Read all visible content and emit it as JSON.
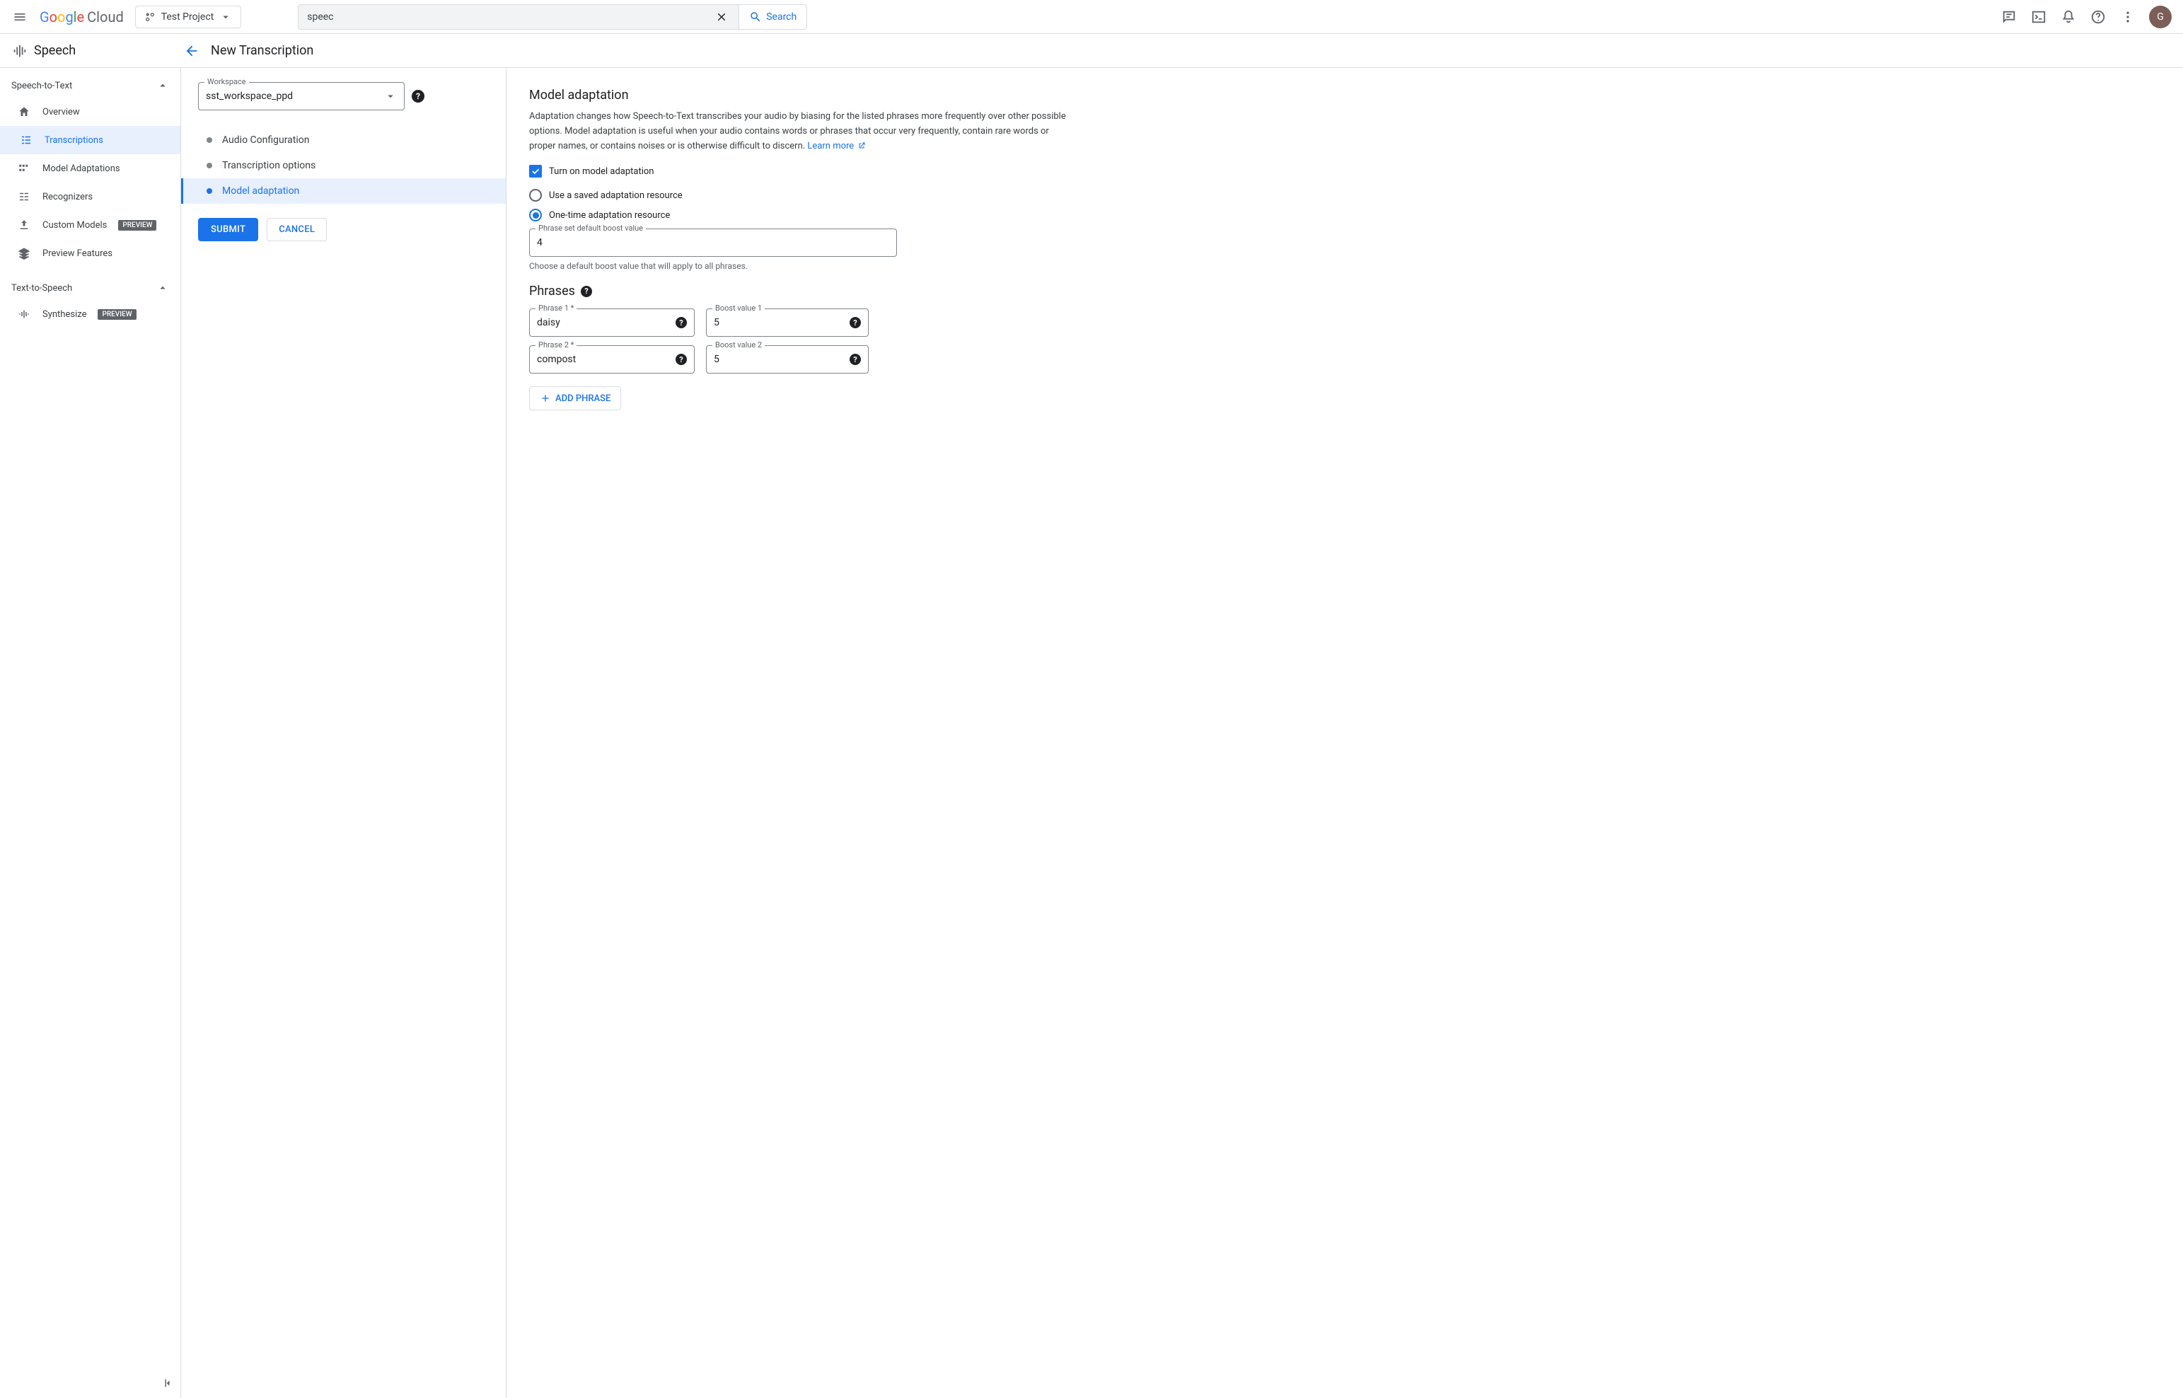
{
  "topbar": {
    "logo_cloud": "Cloud",
    "project": "Test Project",
    "search_value": "speec",
    "search_button": "Search",
    "avatar_letter": "G"
  },
  "product": {
    "name": "Speech",
    "page_title": "New Transcription"
  },
  "sidebar": {
    "section_stt": "Speech-to-Text",
    "items_stt": {
      "overview": "Overview",
      "transcriptions": "Transcriptions",
      "model_adaptations": "Model Adaptations",
      "recognizers": "Recognizers",
      "custom_models": "Custom Models",
      "preview_features": "Preview Features"
    },
    "section_tts": "Text-to-Speech",
    "items_tts": {
      "synthesize": "Synthesize"
    },
    "preview_badge": "PREVIEW"
  },
  "stepper": {
    "workspace_label": "Workspace",
    "workspace_value": "sst_workspace_ppd",
    "steps": {
      "audio": "Audio Configuration",
      "options": "Transcription options",
      "adaptation": "Model adaptation"
    },
    "submit": "SUBMIT",
    "cancel": "CANCEL"
  },
  "content": {
    "title": "Model adaptation",
    "description": "Adaptation changes how Speech-to-Text transcribes your audio by biasing for the listed phrases more frequently over other possible options. Model adaptation is useful when your audio contains words or phrases that occur very frequently, contain rare words or proper names, or contains noises or is otherwise difficult to discern. ",
    "learn_more": "Learn more",
    "checkbox_label": "Turn on model adaptation",
    "radio_saved": "Use a saved adaptation resource",
    "radio_onetime": "One-time adaptation resource",
    "boost_field_label": "Phrase set default boost value",
    "boost_field_value": "4",
    "boost_helper": "Choose a default boost value that will apply to all phrases.",
    "phrases_title": "Phrases",
    "phrases": [
      {
        "label": "Phrase 1 *",
        "value": "daisy",
        "boost_label": "Boost value 1",
        "boost_value": "5"
      },
      {
        "label": "Phrase 2 *",
        "value": "compost",
        "boost_label": "Boost value 2",
        "boost_value": "5"
      }
    ],
    "add_phrase": "ADD PHRASE"
  }
}
